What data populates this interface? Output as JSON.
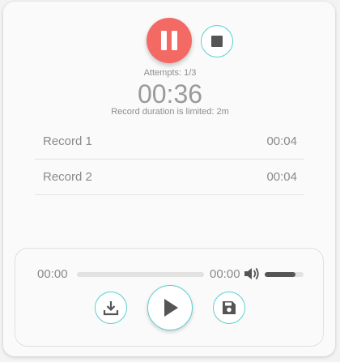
{
  "recorder": {
    "attempts": "Attempts: 1/3",
    "timer": "00:36",
    "limit_text": "Record duration is limited: 2m"
  },
  "records": [
    {
      "name": "Record 1",
      "duration": "00:04"
    },
    {
      "name": "Record 2",
      "duration": "00:04"
    }
  ],
  "player": {
    "current_time": "00:00",
    "total_time": "00:00",
    "progress": 0,
    "volume": 0.8
  },
  "icons": {
    "pause": "pause-icon",
    "stop": "stop-icon",
    "volume": "volume-icon",
    "download": "download-icon",
    "play": "play-icon",
    "save": "save-icon"
  },
  "colors": {
    "record_button": "#f26a63",
    "accent_border": "#5ccfd0",
    "icon_dark": "#555555"
  }
}
